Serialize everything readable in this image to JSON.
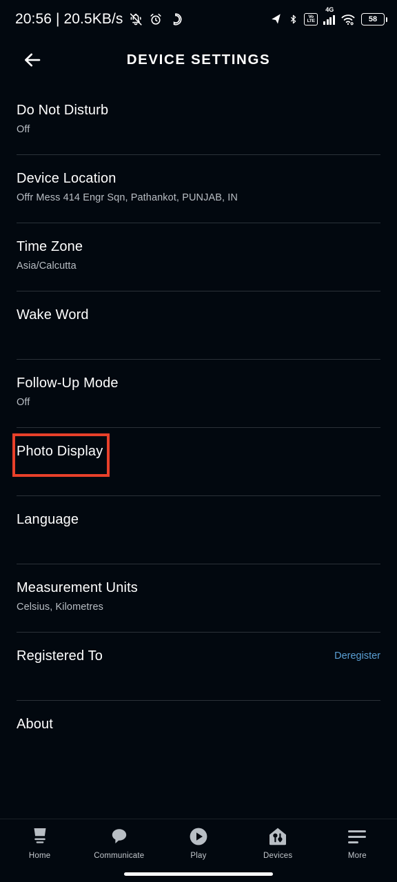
{
  "status_bar": {
    "clock_and_net": "20:56 | 20.5KB/s",
    "left_icons": [
      "silent-mode-icon",
      "alarm-clock-icon",
      "alexa-ring-icon"
    ],
    "right_icons": [
      "location-arrow-icon",
      "bluetooth-icon",
      "volte-icon",
      "mobile-signal-icon",
      "wifi-icon",
      "battery-icon"
    ],
    "volte_top": "Vo",
    "volte_bottom": "LTE",
    "network_type": "4G",
    "battery_level": "58"
  },
  "header": {
    "title": "DEVICE SETTINGS",
    "back_icon": "back-arrow-icon"
  },
  "settings": {
    "rows": [
      {
        "title": "Do Not Disturb",
        "subtitle": "Off",
        "action": "",
        "highlighted": false
      },
      {
        "title": "Device Location",
        "subtitle": "Offr Mess 414 Engr Sqn, Pathankot, PUNJAB, IN",
        "action": "",
        "highlighted": false
      },
      {
        "title": "Time Zone",
        "subtitle": "Asia/Calcutta",
        "action": "",
        "highlighted": false
      },
      {
        "title": "Wake Word",
        "subtitle": "",
        "action": "",
        "highlighted": false
      },
      {
        "title": "Follow-Up Mode",
        "subtitle": "Off",
        "action": "",
        "highlighted": false
      },
      {
        "title": "Photo Display",
        "subtitle": "",
        "action": "",
        "highlighted": true
      },
      {
        "title": "Language",
        "subtitle": "",
        "action": "",
        "highlighted": false
      },
      {
        "title": "Measurement Units",
        "subtitle": "Celsius, Kilometres",
        "action": "",
        "highlighted": false
      },
      {
        "title": "Registered To",
        "subtitle": "",
        "action": "Deregister",
        "highlighted": false
      },
      {
        "title": "About",
        "subtitle": "",
        "action": "",
        "highlighted": false
      }
    ]
  },
  "bottom_nav": {
    "items": [
      {
        "label": "Home",
        "icon": "echo-device-icon"
      },
      {
        "label": "Communicate",
        "icon": "speech-bubble-icon"
      },
      {
        "label": "Play",
        "icon": "play-circle-icon"
      },
      {
        "label": "Devices",
        "icon": "smart-home-icon"
      },
      {
        "label": "More",
        "icon": "hamburger-menu-icon"
      }
    ]
  },
  "colors": {
    "background": "#02080f",
    "highlight_box": "#e8402a",
    "link": "#5a9fd4",
    "divider": "#2b3239",
    "subtitle": "#b9bec4"
  }
}
